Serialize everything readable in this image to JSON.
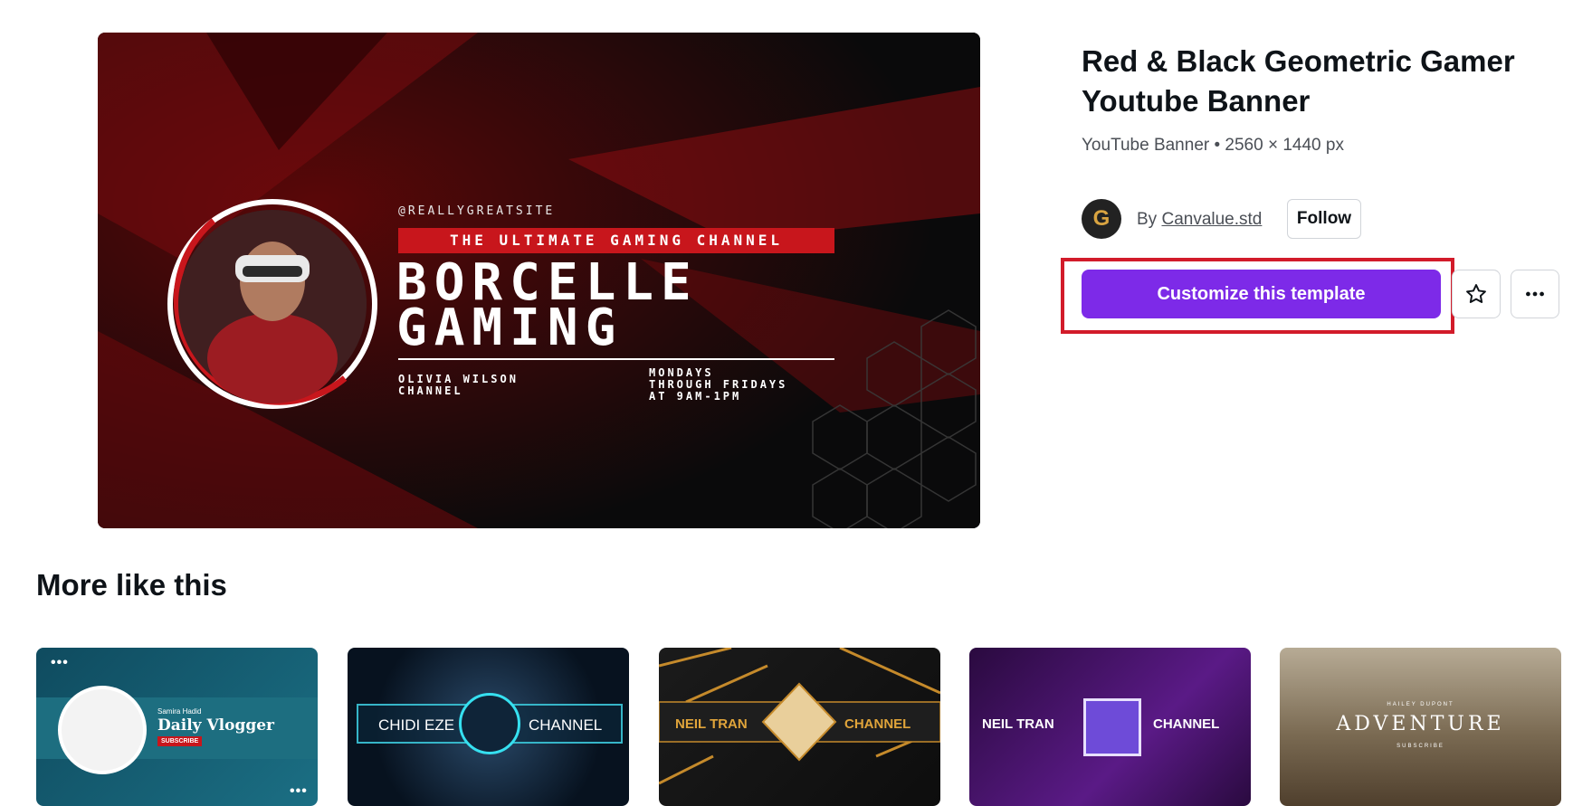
{
  "template": {
    "title": "Red & Black Geometric Gamer Youtube Banner",
    "meta": "YouTube Banner • 2560 × 1440 px",
    "creator": {
      "avatar_letter": "G",
      "by": "By",
      "name": "Canvalue.std"
    },
    "follow_label": "Follow",
    "customize_label": "Customize this template",
    "star_icon": "star-icon",
    "more_icon": "more-icon"
  },
  "banner": {
    "handle": "@REALLYGREATSITE",
    "tagline": "THE ULTIMATE GAMING CHANNEL",
    "title": "BORCELLE\nGAMING",
    "left_sub": "OLIVIA WILSON\nCHANNEL",
    "right_sub": "MONDAYS\nTHROUGH FRIDAYS\nAT 9AM-1PM"
  },
  "more_like_this": {
    "title": "More like this",
    "cards": [
      {
        "name": "Samira Hadid",
        "main": "Daily Vlogger",
        "badge": "SUBSCRIBE"
      },
      {
        "left": "CHIDI EZE",
        "right": "CHANNEL"
      },
      {
        "left": "NEIL TRAN",
        "right": "CHANNEL"
      },
      {
        "left": "NEIL TRAN",
        "right": "CHANNEL"
      },
      {
        "kicker": "HAILEY DUPONT",
        "main": "ADVENTURE",
        "badge": "SUBSCRIBE"
      }
    ]
  },
  "colors": {
    "accent": "#7d2ae8",
    "highlight": "#d21b2a",
    "banner_red": "#c8161c"
  }
}
